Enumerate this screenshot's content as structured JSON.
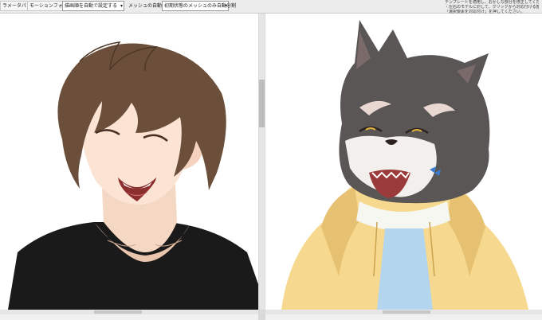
{
  "toolbar": {
    "parameter_palette": "ラメータパレット",
    "motion_folder": "モーションフォルダ",
    "auto_setting_select": "描画順を自動で設定する",
    "mesh_auto_split": "メッシュの自動分割",
    "split_mode_select": "初期状態のメッシュのみ自動分割"
  },
  "notes": [
    "テンプレートを適用し、おかしな部分を修正してください",
    "・左右のモデルに対して、クリックから対応付ける部位を選",
    "「選択要素を対応付け」を押してください。"
  ],
  "icons": {
    "select_arrow": "dropdown-arrow-icon"
  }
}
